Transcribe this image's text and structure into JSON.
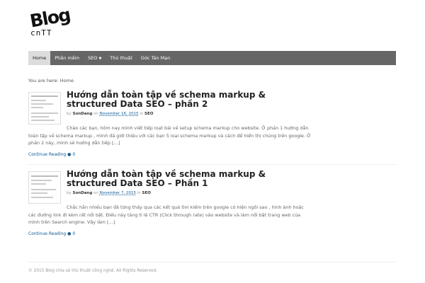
{
  "logo": {
    "word": "Blog",
    "sub": "cnTT"
  },
  "nav": {
    "items": [
      {
        "label": "Home",
        "active": true
      },
      {
        "label": "Phần mềm"
      },
      {
        "label": "SEO",
        "dropdown": true
      },
      {
        "label": "Thủ thuật"
      },
      {
        "label": "Góc Tán Mạn"
      }
    ],
    "caret": "▼"
  },
  "breadcrumb": "You are here: Home",
  "posts": [
    {
      "title": "Hướng dẫn toàn tập về schema markup & structured Data SEO – phần 2",
      "by": "by",
      "author": "SonDang",
      "on": "on",
      "date": "November 16, 2015",
      "in": "in",
      "category": "SEO",
      "excerpt": "Chào các bạn, hôm nay mình viết tiếp loạt bài về setup schema markup cho website. Ở phần 1 hướng dẫn toàn tập về schema markup , mình đã giới thiệu với các bạn 5 loại schema markup và cách để hiển thị chúng trên google. Ở phần 2 này, mình sẽ hướng dẫn tiếp […]",
      "more": "Continue Reading",
      "comments": "0"
    },
    {
      "title": "Hướng dẫn toàn tập về schema markup & structured Data SEO – Phần 1",
      "by": "by",
      "author": "SonDang",
      "on": "on",
      "date": "November 7, 2015",
      "in": "in",
      "category": "SEO",
      "excerpt": "Chắc hẳn nhiều bạn đã từng thấy qua các kết quả tìm kiếm trên google có hiện ngôi sao , hình ảnh hoặc các đường link đi kèm rất nổi bật. Điều này tăng tỉ lệ CTR (Click through rate) vào website và làm nổi bật trang web của mình trên Search engine. Vậy làm […]",
      "more": "Continue Reading",
      "comments": "0"
    }
  ],
  "comment_icon": "comment-bubble-icon",
  "footer": "© 2015 Blog chia sẻ thủ thuật công nghệ. All Rights Reserved."
}
